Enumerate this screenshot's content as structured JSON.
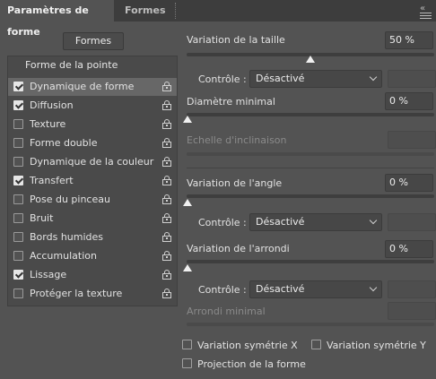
{
  "tabs": [
    {
      "label": "Paramètres de forme",
      "active": true
    },
    {
      "label": "Formes",
      "active": false
    }
  ],
  "close_glyph": "«",
  "formes_button": "Formes",
  "list": {
    "title": "Forme de la pointe",
    "items": [
      {
        "label": "Dynamique de forme",
        "checked": true,
        "selected": true
      },
      {
        "label": "Diffusion",
        "checked": true
      },
      {
        "label": "Texture",
        "checked": false
      },
      {
        "label": "Forme double",
        "checked": false
      },
      {
        "label": "Dynamique de la couleur",
        "checked": false
      },
      {
        "label": "Transfert",
        "checked": true
      },
      {
        "label": "Pose du pinceau",
        "checked": false
      },
      {
        "label": "Bruit",
        "checked": false
      },
      {
        "label": "Bords humides",
        "checked": false
      },
      {
        "label": "Accumulation",
        "checked": false
      },
      {
        "label": "Lissage",
        "checked": true
      },
      {
        "label": "Protéger la texture",
        "checked": false
      }
    ]
  },
  "settings": {
    "size_jitter": {
      "label": "Variation de la taille",
      "value": "50 %",
      "slider_value": 0.5
    },
    "size_control": {
      "label": "Contrôle :",
      "value": "Désactivé"
    },
    "min_diameter": {
      "label": "Diamètre minimal",
      "value": "0 %",
      "slider_value": 0
    },
    "tilt_scale": {
      "label": "Echelle d'inclinaison"
    },
    "angle_jitter": {
      "label": "Variation de l'angle",
      "value": "0 %",
      "slider_value": 0
    },
    "angle_control": {
      "label": "Contrôle :",
      "value": "Désactivé"
    },
    "roundness_jitter": {
      "label": "Variation de l'arrondi",
      "value": "0 %",
      "slider_value": 0
    },
    "roundness_control": {
      "label": "Contrôle :",
      "value": "Désactivé"
    },
    "min_roundness": {
      "label": "Arrondi minimal"
    }
  },
  "options": {
    "flip_x": {
      "label": "Variation symétrie X",
      "checked": false
    },
    "flip_y": {
      "label": "Variation symétrie Y",
      "checked": false
    },
    "projection": {
      "label": "Projection de la forme",
      "checked": false
    }
  }
}
